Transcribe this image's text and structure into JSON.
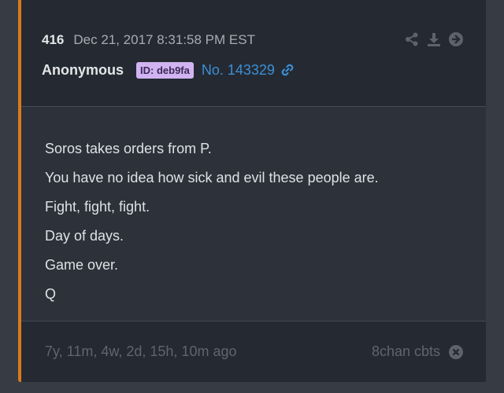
{
  "post": {
    "number": "416",
    "date": "Dec 21, 2017 8:31:58 PM EST",
    "author": "Anonymous",
    "id_badge": "ID: deb9fa",
    "post_link": "No. 143329",
    "body_lines": [
      "Soros takes orders from P.",
      "You have no idea how sick and evil these people are.",
      "Fight, fight, fight.",
      "Day of days.",
      "Game over.",
      "Q"
    ],
    "relative_time": "7y, 11m, 4w, 2d, 15h, 10m ago",
    "source": "8chan cbts"
  },
  "colors": {
    "accent_bar": "#d97a1e",
    "badge_bg": "#d1b3f2",
    "link": "#3b8fd6"
  },
  "icons": {
    "share": "share-icon",
    "download": "download-icon",
    "goto": "arrow-right-circle-icon",
    "link": "link-icon",
    "close": "close-circle-icon"
  }
}
